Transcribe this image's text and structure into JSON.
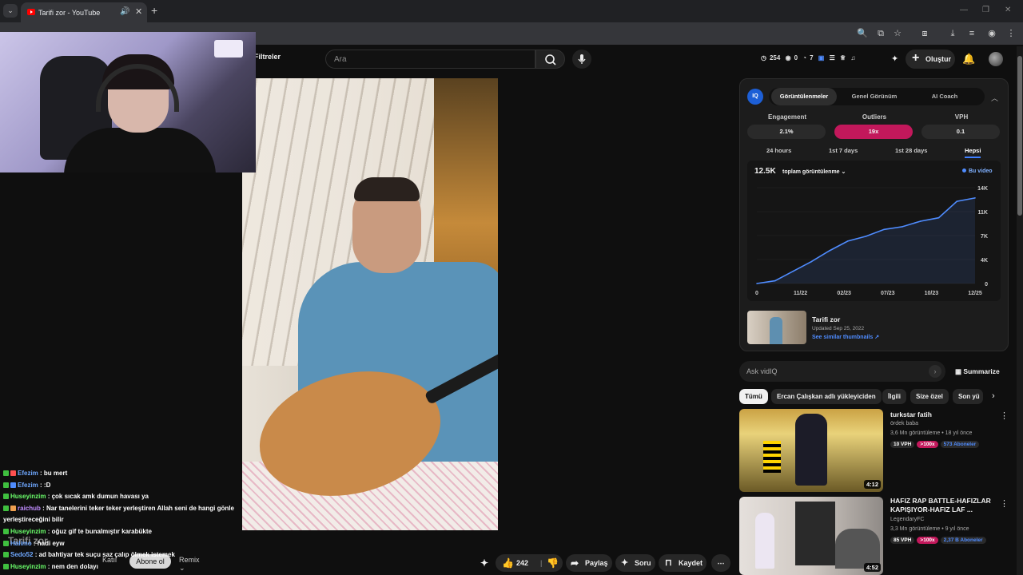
{
  "browser": {
    "tab_title": "Tarifi zor - YouTube",
    "tab_close": "✕",
    "new_tab": "+",
    "tab_menu": "⌄",
    "window_controls": [
      "—",
      "❐",
      "✕"
    ]
  },
  "header": {
    "filters_label": "Filtreler",
    "search_placeholder": "Ara",
    "stats": {
      "views": "254",
      "eye": "0",
      "clock": "7"
    },
    "create_label": "Oluştur",
    "create_icon": "+"
  },
  "chat": [
    {
      "user": "Efezim",
      "user_color": "u-blue",
      "msg": ": bu mert"
    },
    {
      "user": "Efezim",
      "user_color": "u-blue",
      "msg": ": :D"
    },
    {
      "user": "Huseyinzim",
      "user_color": "u-green",
      "msg": ": çok sıcak amk dumun havası ya"
    },
    {
      "user": "raichub",
      "user_color": "u-purple",
      "msg": ": Nar tanelerini teker teker yerleştiren Allah seni de hangi gönle yerleştireceğini bilir"
    },
    {
      "user": "Huseyinzim",
      "user_color": "u-green",
      "msg": ": oğuz gif te bunalmıştır karabükte"
    },
    {
      "user": "Halimo",
      "user_color": "u-blue",
      "msg": ": hadi eyw"
    },
    {
      "user": "Sedo52",
      "user_color": "u-blue",
      "msg": ": ad bahtiyar tek suçu saz çalıp ölmek istemek"
    },
    {
      "user": "Huseyinzim",
      "user_color": "u-green",
      "msg": ": nem den dolayı"
    }
  ],
  "under_video": {
    "ghost_title": "Tarifi zor",
    "join_label": "Katıl",
    "subscribe_label": "Abone ol",
    "remix_label": "Remix"
  },
  "actions": {
    "likes": "242",
    "share_label": "Paylaş",
    "ask_label": "Soru",
    "save_label": "Kaydet",
    "more": "⋯"
  },
  "vidiq": {
    "logo": "IQ",
    "tabs": [
      "Görüntülenmeler",
      "Genel Görünüm",
      "AI Coach"
    ],
    "active_tab": "Görüntülenmeler",
    "metrics": [
      {
        "label": "Engagement",
        "value": "2.1%"
      },
      {
        "label": "Outliers",
        "value": "19x"
      },
      {
        "label": "VPH",
        "value": "0.1"
      }
    ],
    "ranges": [
      "24 hours",
      "1st 7 days",
      "1st 28 days",
      "Hepsi"
    ],
    "active_range": "Hepsi",
    "total": "12.5K",
    "metric_label": "toplam görüntülenme",
    "legend": "Bu video",
    "thumb_title": "Tarifi zor",
    "thumb_updated": "Updated Sep 25, 2022",
    "thumb_link": "See similar thumbnails ↗",
    "ask_placeholder": "Ask vidIQ",
    "summarize_label": "Summarize",
    "accent": "#1d5fd6",
    "outlier_color": "#c2185b"
  },
  "chart_data": {
    "type": "line",
    "x": [
      "0",
      "11/22",
      "02/23",
      "07/23",
      "10/23",
      "12/25"
    ],
    "y_ticks": [
      "0",
      "4K",
      "7K",
      "11K",
      "14K"
    ],
    "series": [
      {
        "name": "Bu video",
        "values": [
          0,
          400,
          1800,
          3200,
          4800,
          6200,
          6900,
          7900,
          8300,
          9100,
          9600,
          12000,
          12500
        ]
      }
    ],
    "ylim": [
      0,
      14000
    ],
    "grid": true,
    "legend": "top-right",
    "title": "",
    "xlabel": "",
    "ylabel": ""
  },
  "chips": [
    "Tümü",
    "Ercan Çalışkan adlı yükleyiciden",
    "İlgili",
    "Size özel",
    "Son yü"
  ],
  "recommendations": [
    {
      "title": "turkstar fatih",
      "channel": "ördek baba",
      "meta": "3,6 Mn görüntüleme • 18 yıl önce",
      "vph": "10 VPH",
      "outlier": ">100x",
      "subs": "573 Aboneler",
      "duration": "4:12"
    },
    {
      "title": "HAFIZ RAP BATTLE-HAFIZLAR KAPIŞIYOR-HAFIZ LAF ...",
      "channel": "LegendaryFC",
      "meta": "3,3 Mn görüntüleme • 9 yıl önce",
      "vph": "85 VPH",
      "outlier": ">100x",
      "subs": "2,37 B Aboneler",
      "duration": "4:52"
    }
  ]
}
